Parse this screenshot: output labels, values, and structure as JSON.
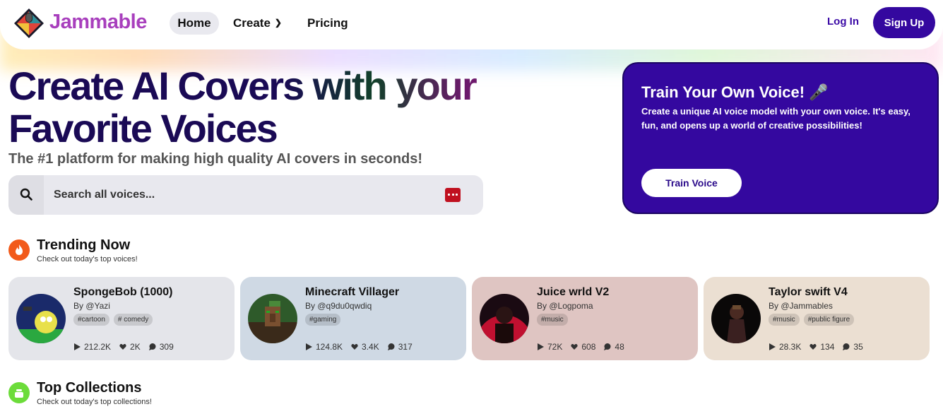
{
  "nav": {
    "brand": "Jammable",
    "home": "Home",
    "create": "Create",
    "pricing": "Pricing",
    "login": "Log In",
    "signup": "Sign Up"
  },
  "hero": {
    "title": "Create AI Covers with your Favorite Voices",
    "subtitle": "The #1 platform for making high quality AI covers in seconds!",
    "search_placeholder": "Search all voices..."
  },
  "promo": {
    "title": "Train Your Own Voice! 🎤",
    "description": "Create a unique AI voice model with your own voice. It's easy, fun, and opens up a world of creative possibilities!",
    "button": "Train Voice"
  },
  "trending": {
    "title": "Trending Now",
    "subtitle": "Check out today's top voices!",
    "cards": [
      {
        "name": "SpongeBob (1000)",
        "author": "By @Yazi",
        "tags": [
          "#cartoon",
          "# comedy"
        ],
        "plays": "212.2K",
        "likes": "2K",
        "comments": "309",
        "bg": "#e4e5ea"
      },
      {
        "name": "Minecraft Villager",
        "author": "By @q9du0qwdiq",
        "tags": [
          "#gaming"
        ],
        "plays": "124.8K",
        "likes": "3.4K",
        "comments": "317",
        "bg": "#cfd9e4"
      },
      {
        "name": "Juice wrld V2",
        "author": "By @Logpoma",
        "tags": [
          "#music"
        ],
        "plays": "72K",
        "likes": "608",
        "comments": "48",
        "bg": "#dfc5c2"
      },
      {
        "name": "Taylor swift V4",
        "author": "By @Jammables",
        "tags": [
          "#music",
          "#public figure"
        ],
        "plays": "28.3K",
        "likes": "134",
        "comments": "35",
        "bg": "#ebdfd2"
      }
    ]
  },
  "collections": {
    "title": "Top Collections",
    "subtitle": "Check out today's top collections!"
  },
  "colors": {
    "brand_purple": "#34089f",
    "trending_orange": "#f25a1a",
    "collections_green": "#6cdc3a"
  }
}
